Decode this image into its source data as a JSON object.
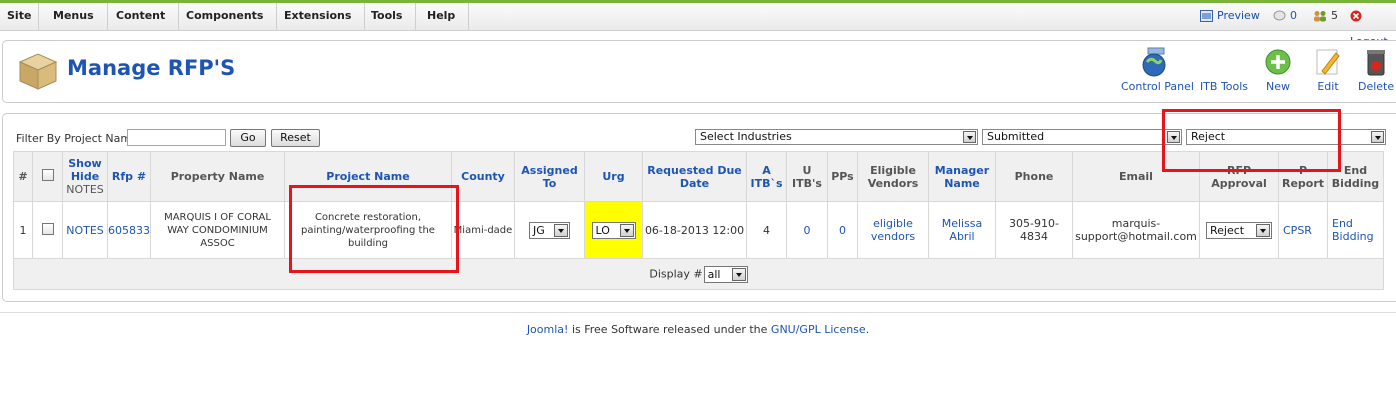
{
  "menubar": {
    "items": [
      "Site",
      "Menus",
      "Content",
      "Components",
      "Extensions",
      "Tools",
      "Help"
    ],
    "preview": "Preview",
    "messages_count": "0",
    "users_count": "5",
    "logout": "Logout"
  },
  "header": {
    "title": "Manage RFP'S",
    "toolbar": {
      "control_panel": "Control Panel",
      "itb_tools": "ITB Tools",
      "new": "New",
      "edit": "Edit",
      "delete": "Delete"
    }
  },
  "filter": {
    "label": "Filter By Project Name:",
    "input_value": "",
    "go": "Go",
    "reset": "Reset",
    "industries": "Select Industries",
    "status": "Submitted",
    "approval": "Reject"
  },
  "table": {
    "headers": {
      "num": "#",
      "show_hide_1": "Show",
      "show_hide_2": "Hide",
      "show_hide_3": "NOTES",
      "rfp": "Rfp #",
      "property": "Property Name",
      "project": "Project Name",
      "county": "County",
      "assigned_1": "Assigned",
      "assigned_2": "To",
      "urg": "Urg",
      "due_1": "Requested Due",
      "due_2": "Date",
      "a_itb_1": "A",
      "a_itb_2": "ITB`s",
      "u_itb_1": "U",
      "u_itb_2": "ITB's",
      "pps": "PPs",
      "eligible_1": "Eligible",
      "eligible_2": "Vendors",
      "manager_1": "Manager",
      "manager_2": "Name",
      "phone": "Phone",
      "email": "Email",
      "approval_1": "RFP",
      "approval_2": "Approval",
      "report_1": "P",
      "report_2": "Report",
      "end_1": "End",
      "end_2": "Bidding"
    },
    "rows": [
      {
        "num": "1",
        "notes": "NOTES",
        "rfp": "605833",
        "property_1": "MARQUIS I OF CORAL",
        "property_2": "WAY CONDOMINIUM",
        "property_3": "ASSOC",
        "project_1": "Concrete restoration,",
        "project_2": "painting/waterproofing the",
        "project_3": "building",
        "county": "Miami-dade",
        "assigned": "JG",
        "urg": "LO",
        "due": "06-18-2013 12:00",
        "a_itbs": "4",
        "u_itbs": "0",
        "pps": "0",
        "eligible_1": "eligible",
        "eligible_2": "vendors",
        "manager_1": "Melissa",
        "manager_2": "Abril",
        "phone": "305-910-4834",
        "email_1": "marquis-",
        "email_2": "support@hotmail.com",
        "approval": "Reject",
        "report": "CPSR",
        "end_1": "End",
        "end_2": "Bidding"
      }
    ],
    "display_label": "Display #",
    "display_value": "all"
  },
  "footer": {
    "joomla": "Joomla!",
    "text": " is Free Software released under the ",
    "license": "GNU/GPL License",
    "dot": "."
  },
  "colors": {
    "accent_blue": "#1e55b3",
    "menubar_green": "#7bb33a",
    "urgent_yellow": "#ffff00",
    "highlight_red": "#e8141c"
  }
}
